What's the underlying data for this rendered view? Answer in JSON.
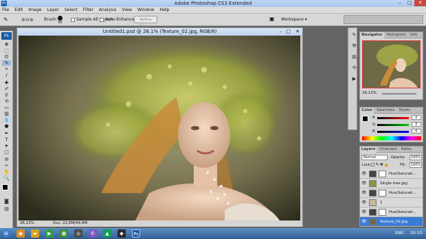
{
  "window": {
    "title": "Adobe Photoshop CS3 Extended",
    "app_badge": "Ps"
  },
  "menu": [
    "File",
    "Edit",
    "Image",
    "Layer",
    "Select",
    "Filter",
    "Analysis",
    "View",
    "Window",
    "Help"
  ],
  "options": {
    "brush_label": "Brush:",
    "brush_size": "30",
    "sample_all_layers": "Sample All Layers",
    "auto_enhance": "Auto-Enhance",
    "refine_edge": "Refine Edge...",
    "workspace": "Workspace ▾"
  },
  "document": {
    "title": "Untitled1.psd @ 26,1% (Texture_02.jpg, RGB/8)",
    "zoom": "26,13%",
    "doc_size": "Doc: 22,8M/94,8M"
  },
  "navigator": {
    "tabs": [
      "Navigator",
      "Histogram",
      "Info"
    ],
    "zoom": "26.13%"
  },
  "color": {
    "tabs": [
      "Color",
      "Swatches",
      "Styles"
    ],
    "channels": [
      {
        "label": "R",
        "value": "0"
      },
      {
        "label": "G",
        "value": "0"
      },
      {
        "label": "B",
        "value": "0"
      }
    ]
  },
  "layers": {
    "tabs": [
      "Layers",
      "Channels",
      "Paths"
    ],
    "blend_mode": "Normal",
    "opacity_label": "Opacity:",
    "opacity": "100%",
    "lock_label": "Lock:",
    "fill_label": "Fill:",
    "fill": "100%",
    "rows": [
      {
        "name": "Hue/Saturati..."
      },
      {
        "name": "Single tree.jpg"
      },
      {
        "name": "Hue/Saturati..."
      },
      {
        "name": "1"
      },
      {
        "name": "Hue/Saturati..."
      },
      {
        "name": "Texture_02.jpg"
      }
    ]
  },
  "taskbar": {
    "language": "ENG",
    "time": "20:10"
  },
  "colors": {
    "selected_layer": "#3a7bd5",
    "titlebar": "#bcd4f2",
    "taskbar": "#2f5e93"
  }
}
